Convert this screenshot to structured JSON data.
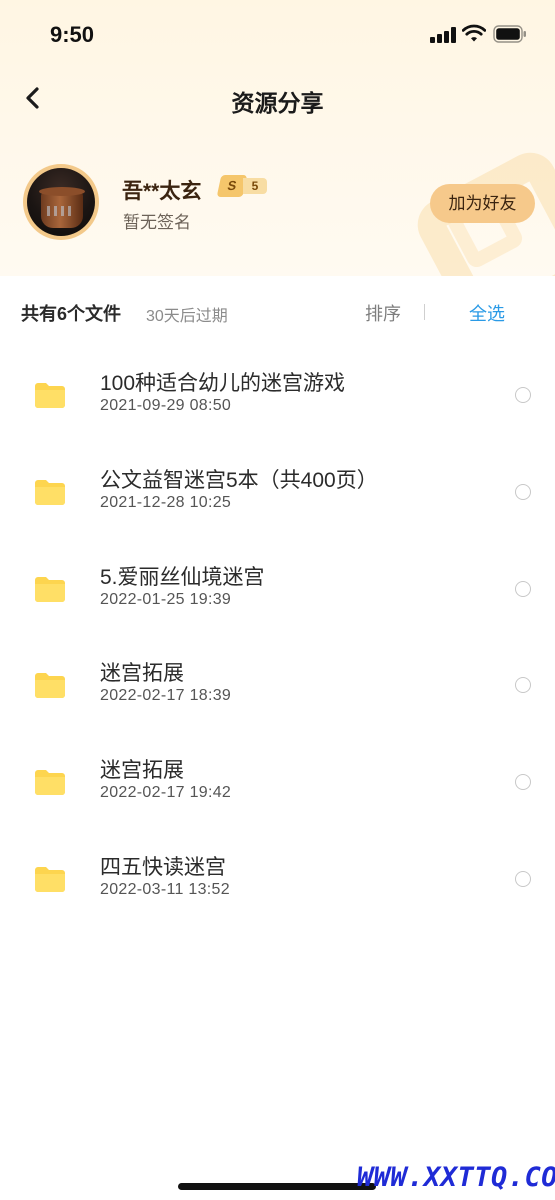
{
  "status_bar": {
    "time": "9:50"
  },
  "nav": {
    "title": "资源分享"
  },
  "profile": {
    "name": "吾**太玄",
    "level_letter": "S",
    "level_num": "5",
    "signature": "暂无签名",
    "add_friend_label": "加为好友"
  },
  "toolbar": {
    "file_count": "共有6个文件",
    "expire": "30天后过期",
    "sort_label": "排序",
    "select_all_label": "全选"
  },
  "files": [
    {
      "name": "100种适合幼儿的迷宫游戏",
      "date": "2021-09-29 08:50"
    },
    {
      "name": "公文益智迷宫5本（共400页）",
      "date": "2021-12-28 10:25"
    },
    {
      "name": "5.爱丽丝仙境迷宫",
      "date": "2022-01-25 19:39"
    },
    {
      "name": "迷宫拓展",
      "date": "2022-02-17 18:39"
    },
    {
      "name": "迷宫拓展",
      "date": "2022-02-17 19:42"
    },
    {
      "name": "四五快读迷宫",
      "date": "2022-03-11 13:52"
    }
  ],
  "watermark": "WWW.XXTTQ.COM",
  "colors": {
    "accent_blue": "#2a9ae6",
    "button_gold": "#f6c98b",
    "folder_yellow": "#fdd54f"
  }
}
